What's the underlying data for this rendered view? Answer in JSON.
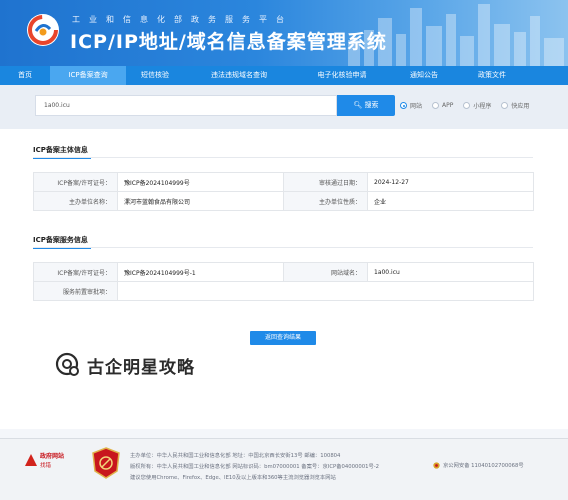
{
  "header": {
    "subtitle": "工业和信息化部政务服务平台",
    "title": "ICP/IP地址/域名信息备案管理系统"
  },
  "nav": {
    "items": [
      {
        "label": "首页",
        "active": false
      },
      {
        "label": "ICP备案查询",
        "active": true
      },
      {
        "label": "短信核验",
        "active": false
      },
      {
        "label": "违法违规域名查询",
        "active": false
      },
      {
        "label": "电子化核验申请",
        "active": false
      },
      {
        "label": "通知公告",
        "active": false
      },
      {
        "label": "政策文件",
        "active": false
      }
    ]
  },
  "search": {
    "value": "1a00.icu",
    "button_label": "搜索",
    "options": [
      {
        "label": "网站",
        "selected": true
      },
      {
        "label": "APP",
        "selected": false
      },
      {
        "label": "小程序",
        "selected": false
      },
      {
        "label": "快应用",
        "selected": false
      }
    ]
  },
  "subject": {
    "title": "ICP备案主体信息",
    "license_label": "ICP备案/许可证号：",
    "license_value": "豫ICP备2024104999号",
    "approved_label": "审核通过日期：",
    "approved_value": "2024-12-27",
    "org_label": "主办单位名称：",
    "org_value": "漯河市蓝翰食品有限公司",
    "nature_label": "主办单位性质：",
    "nature_value": "企业"
  },
  "service": {
    "title": "ICP备案服务信息",
    "license_label": "ICP备案/许可证号：",
    "license_value": "豫ICP备2024104999号-1",
    "domain_label": "网站域名：",
    "domain_value": "1a00.icu",
    "preapproval_label": "服务前置审批项：",
    "preapproval_value": ""
  },
  "back_button": "返回查询结果",
  "watermark": "古企明星攻略",
  "footer": {
    "gov_logo_text": "政府网站",
    "gov_logo_sub": "找错",
    "line1": "主办单位：中华人民共和国工业和信息化部    地址：中国北京西长安街13号    邮编：100804",
    "line2": "版权所有：中华人民共和国工业和信息化部    网站标识码：bm07000001    备案号：京ICP备04000001号-2",
    "police": "京公网安备 11040102700068号",
    "line3": "建议您使用Chrome、Firefox、Edge、IE10及以上版本和360等主流浏览器浏览本网站"
  },
  "colors": {
    "primary": "#1f8ae8",
    "nav": "#1a86df",
    "nav_active": "#4aa7f0"
  }
}
